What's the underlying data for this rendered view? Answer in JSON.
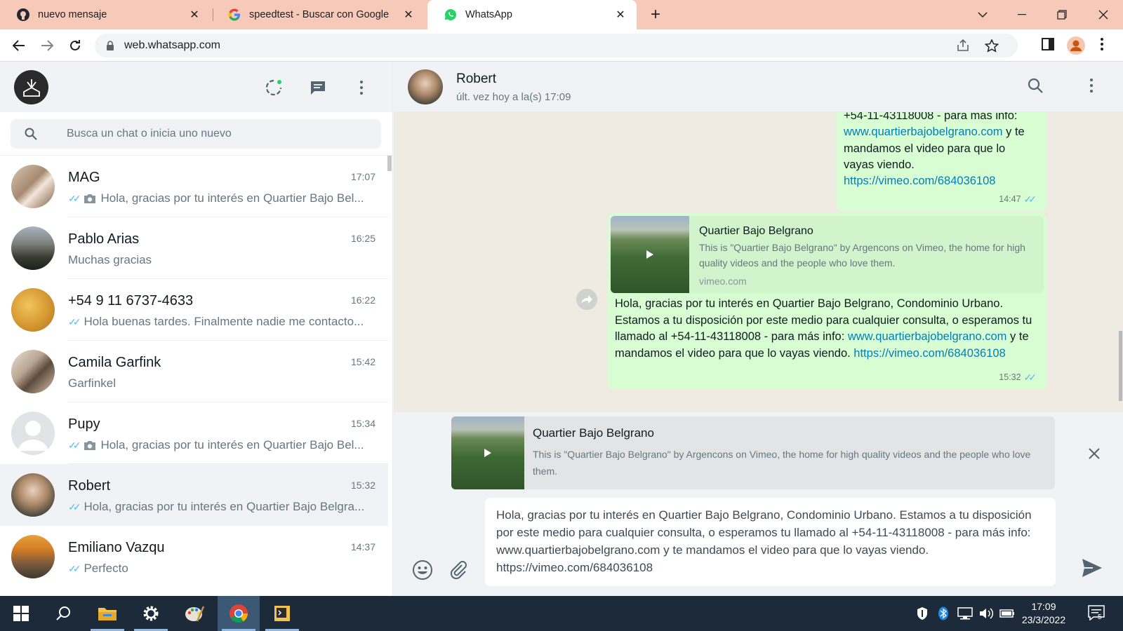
{
  "browser": {
    "tabs": [
      {
        "title": "nuevo mensaje",
        "icon": "github-icon"
      },
      {
        "title": "speedtest - Buscar con Google",
        "icon": "google-icon"
      },
      {
        "title": "WhatsApp",
        "icon": "whatsapp-icon",
        "active": true
      }
    ],
    "url": "web.whatsapp.com"
  },
  "sidebar": {
    "search_placeholder": "Busca un chat o inicia uno nuevo",
    "chats": [
      {
        "name": "MAG",
        "time": "17:07",
        "ticks": true,
        "photo": true,
        "preview": "Hola, gracias por tu interés en Quartier Bajo Bel..."
      },
      {
        "name": "Pablo Arias",
        "time": "16:25",
        "ticks": false,
        "photo": false,
        "preview": "Muchas gracias"
      },
      {
        "name": "+54 9 11 6737-4633",
        "time": "16:22",
        "ticks": true,
        "photo": false,
        "preview": "Hola buenas tardes. Finalmente nadie me contacto..."
      },
      {
        "name": "Camila Garfink",
        "time": "15:42",
        "ticks": false,
        "photo": false,
        "preview": "Garfinkel"
      },
      {
        "name": "Pupy",
        "time": "15:34",
        "ticks": true,
        "photo": true,
        "preview": "Hola, gracias por tu interés en Quartier Bajo Bel..."
      },
      {
        "name": "Robert",
        "time": "15:32",
        "ticks": true,
        "photo": false,
        "preview": "Hola, gracias por tu interés en Quartier Bajo Belgra...",
        "selected": true
      },
      {
        "name": "Emiliano Vazqu",
        "time": "14:37",
        "ticks": true,
        "photo": false,
        "preview": "Perfecto"
      }
    ]
  },
  "conversation": {
    "contact_name": "Robert",
    "status": "últ. vez hoy a la(s) 17:09",
    "msg1": {
      "line1": "+54-11-43118008  - para más info:",
      "link1": "www.quartierbajobelgrano.com",
      "text1": " y te",
      "line3": "mandamos el video para que lo",
      "line4": "vayas viendo.",
      "link2": "https://vimeo.com/684036108",
      "time": "14:47"
    },
    "msg2": {
      "preview_title": "Quartier Bajo Belgrano",
      "preview_desc": "This is \"Quartier Bajo Belgrano\" by Argencons on Vimeo, the home for high quality videos and the people who love them.",
      "preview_domain": "vimeo.com",
      "text_before": "Hola, gracias por tu interés en Quartier Bajo Belgrano, Condominio Urbano. Estamos a tu disposición por este medio para cualquier consulta, o esperamos tu llamado al +54-11-43118008  - para más info: ",
      "link1": "www.quartierbajobelgrano.com",
      "text_mid": " y te mandamos el video para que lo vayas viendo. ",
      "link2": "https://vimeo.com/684036108",
      "time": "15:32"
    },
    "draft_preview": {
      "title": "Quartier Bajo Belgrano",
      "desc": "This is \"Quartier Bajo Belgrano\" by Argencons on Vimeo, the home for high quality videos and the people who love them."
    },
    "compose_text": "Hola, gracias por tu interés en Quartier Bajo Belgrano, Condominio Urbano. Estamos a tu disposición por este medio para cualquier consulta, o esperamos tu llamado al +54-11-43118008  - para más info: www.quartierbajobelgrano.com y te mandamos el video para que lo vayas viendo. https://vimeo.com/684036108"
  },
  "taskbar": {
    "time": "17:09",
    "date": "23/3/2022",
    "notifications": "5"
  },
  "colors": {
    "outgoing_bubble": "#d9fdd3",
    "chat_background": "#efeae2",
    "tick_read": "#53bdeb",
    "link": "#027eb5",
    "tab_strip": "#f7c9b8"
  }
}
